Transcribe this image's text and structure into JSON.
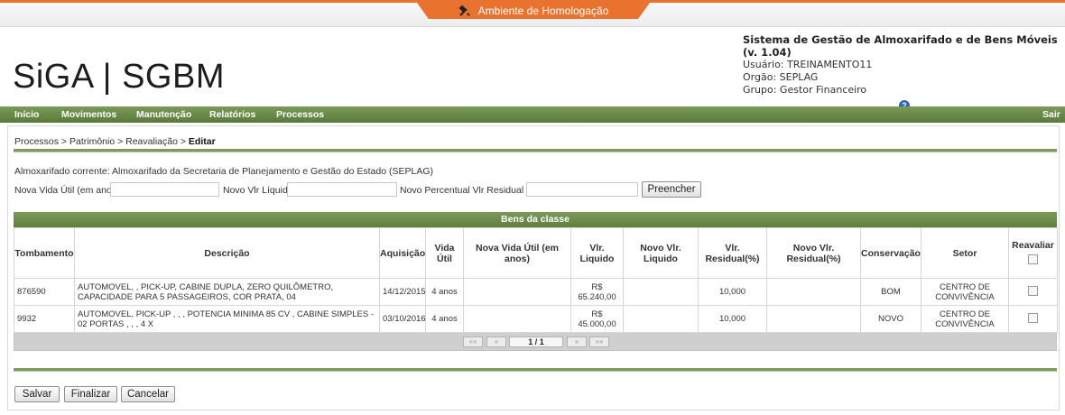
{
  "environment": {
    "label": "Ambiente de Homologação",
    "icon": "tools-icon"
  },
  "logo": {
    "text": "SiGA | SGBM"
  },
  "system": {
    "title": "Sistema de Gestão de Almoxarifado e de Bens Móveis (v. 1.04)",
    "user": "Usuário: TREINAMENTO11",
    "org": "Orgão: SEPLAG",
    "group": "Grupo: Gestor Financeiro",
    "help_icon": "help-icon"
  },
  "menu": {
    "items": [
      "Início",
      "Movimentos",
      "Manutenção",
      "Relatórios",
      "Processos"
    ],
    "logout": "Sair"
  },
  "breadcrumb": {
    "path": "Processos  > Patrimônio  >  Reavaliação  >",
    "current": "Editar"
  },
  "form": {
    "almoxarifado": "Almoxarifado corrente: Almoxarifado da Secretaria de Planejamento e Gestão do Estado (SEPLAG)",
    "vida_util_label": "Nova Vida Útil (em anos):",
    "vlr_liquido_label": "Novo Vlr Líquido:",
    "perc_residual_label": "Novo Percentual Vlr Residual (%):",
    "vida_util_value": "",
    "vlr_liquido_value": "",
    "perc_residual_value": "",
    "fill_button": "Preencher"
  },
  "table": {
    "caption": "Bens da classe",
    "columns": [
      "Tombamento",
      "Descrição",
      "Aquisição",
      "Vida Útil",
      "Nova Vida Útil (em anos)",
      "Vlr. Liquido",
      "Novo Vlr. Liquido",
      "Vlr. Residual(%)",
      "Novo Vlr. Residual(%)",
      "Conservação",
      "Setor",
      "Reavaliar"
    ],
    "rows": [
      {
        "tombamento": "876590",
        "descricao": "AUTOMOVEL, , PICK-UP, CABINE DUPLA, ZERO QUILÔMETRO, CAPACIDADE PARA 5 PASSAGEIROS, COR PRATA, 04",
        "aquisicao": "14/12/2015",
        "vida_util": "4 anos",
        "nova_vida_util": "",
        "vlr_liquido_currency": "R$",
        "vlr_liquido": "65.240,00",
        "novo_vlr_liquido": "",
        "vlr_residual": "10,000",
        "novo_vlr_residual": "",
        "conservacao": "BOM",
        "setor_1": "CENTRO DE",
        "setor_2": "CONVIVÊNCIA"
      },
      {
        "tombamento": "9932",
        "descricao": "AUTOMOVEL, PICK-UP , , , POTENCIA MINIMA 85 CV , CABINE SIMPLES - 02 PORTAS , , , 4 X",
        "aquisicao": "03/10/2016",
        "vida_util": "4 anos",
        "nova_vida_util": "",
        "vlr_liquido_currency": "R$",
        "vlr_liquido": "45.000,00",
        "novo_vlr_liquido": "",
        "vlr_residual": "10,000",
        "novo_vlr_residual": "",
        "conservacao": "NOVO",
        "setor_1": "CENTRO DE",
        "setor_2": "CONVIVÊNCIA"
      }
    ],
    "pager": {
      "first": "««",
      "prev": "«",
      "info": "1 / 1",
      "next": "»",
      "last": "»»"
    }
  },
  "actions": {
    "save": "Salvar",
    "finalize": "Finalizar",
    "cancel": "Cancelar"
  }
}
